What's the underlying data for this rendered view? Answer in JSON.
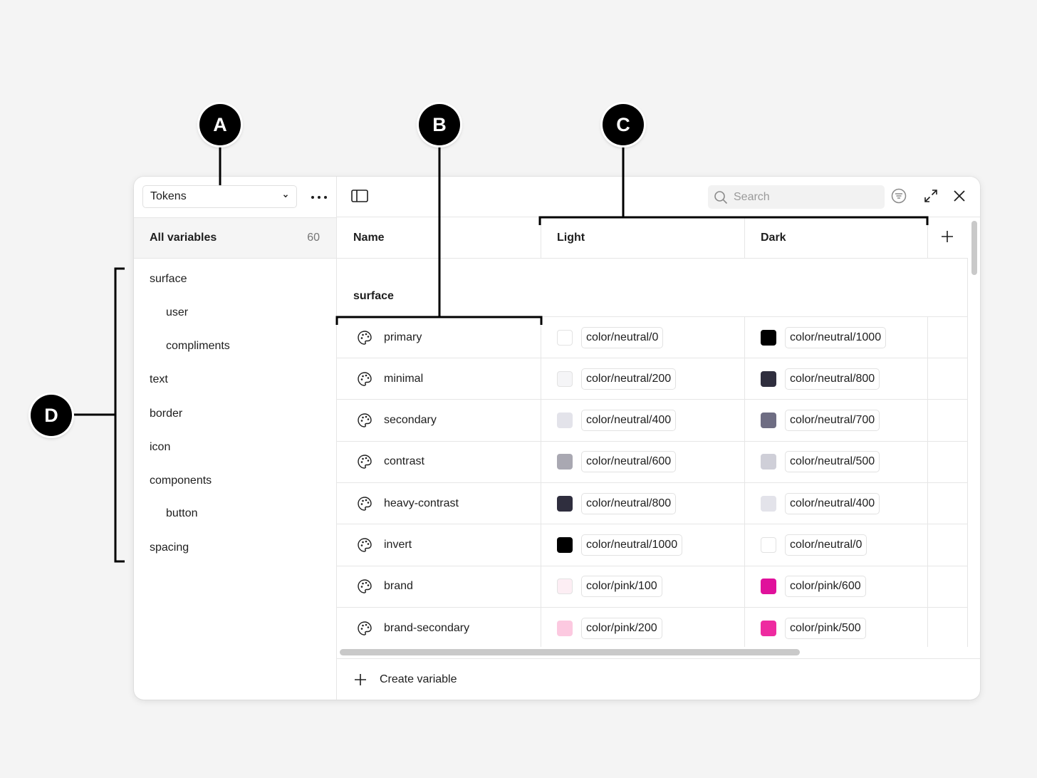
{
  "sidebar": {
    "collection_select": "Tokens",
    "all_variables_label": "All variables",
    "all_variables_count": "60",
    "groups": [
      {
        "label": "surface",
        "indent": 0
      },
      {
        "label": "user",
        "indent": 1
      },
      {
        "label": "compliments",
        "indent": 1
      },
      {
        "label": "text",
        "indent": 0
      },
      {
        "label": "border",
        "indent": 0
      },
      {
        "label": "icon",
        "indent": 0
      },
      {
        "label": "components",
        "indent": 0
      },
      {
        "label": "button",
        "indent": 1
      },
      {
        "label": "spacing",
        "indent": 0
      }
    ]
  },
  "toolbar": {
    "search_placeholder": "Search"
  },
  "table": {
    "columns": [
      "Name",
      "Light",
      "Dark"
    ],
    "group_label": "surface",
    "rows": [
      {
        "name": "primary",
        "light": "color/neutral/0",
        "light_color": "#ffffff",
        "dark": "color/neutral/1000",
        "dark_color": "#000000"
      },
      {
        "name": "minimal",
        "light": "color/neutral/200",
        "light_color": "#f5f5f7",
        "dark": "color/neutral/800",
        "dark_color": "#2f2e3e"
      },
      {
        "name": "secondary",
        "light": "color/neutral/400",
        "light_color": "#e3e3ea",
        "dark": "color/neutral/700",
        "dark_color": "#6e6d83"
      },
      {
        "name": "contrast",
        "light": "color/neutral/600",
        "light_color": "#a9a8b2",
        "dark": "color/neutral/500",
        "dark_color": "#cfcfd8"
      },
      {
        "name": "heavy-contrast",
        "light": "color/neutral/800",
        "light_color": "#2f2e3e",
        "dark": "color/neutral/400",
        "dark_color": "#e3e3ea"
      },
      {
        "name": "invert",
        "light": "color/neutral/1000",
        "light_color": "#000000",
        "dark": "color/neutral/0",
        "dark_color": "#ffffff"
      },
      {
        "name": "brand",
        "light": "color/pink/100",
        "light_color": "#fdeef4",
        "dark": "color/pink/600",
        "dark_color": "#e0119b"
      },
      {
        "name": "brand-secondary",
        "light": "color/pink/200",
        "light_color": "#fcc9e0",
        "dark": "color/pink/500",
        "dark_color": "#ee2ba0"
      }
    ]
  },
  "footer": {
    "create_label": "Create variable"
  },
  "callouts": [
    "A",
    "B",
    "C",
    "D"
  ]
}
